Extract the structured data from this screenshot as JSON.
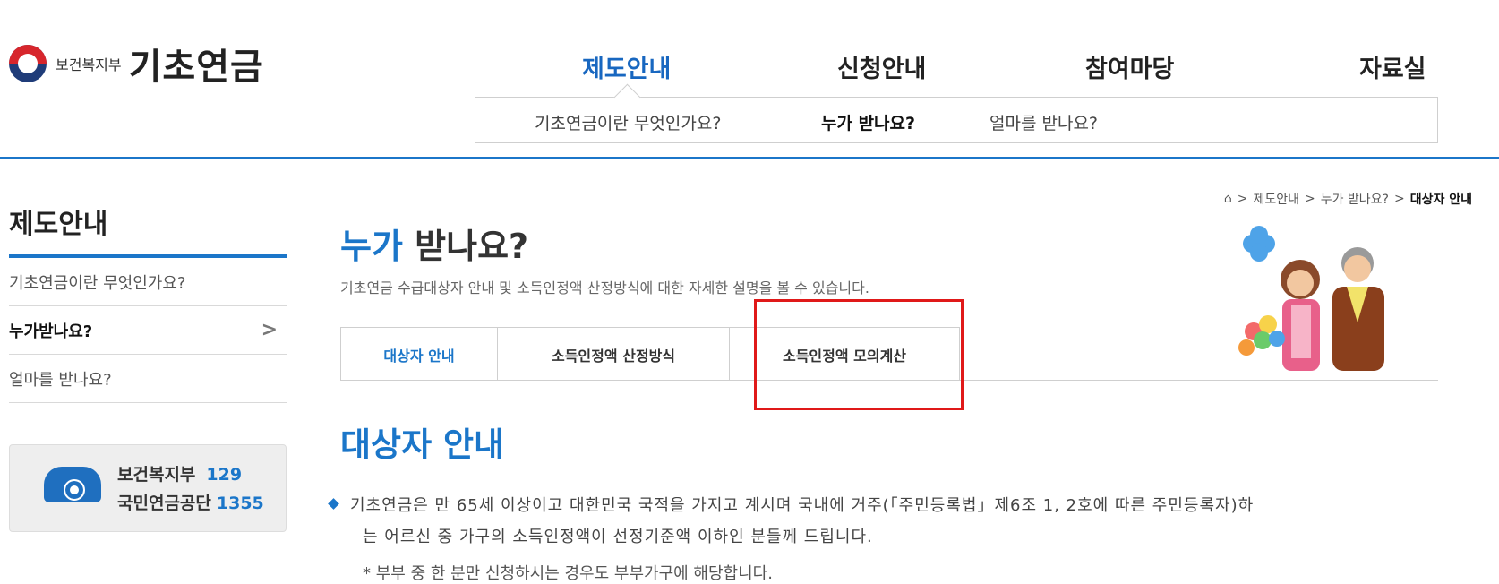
{
  "header": {
    "logo_sub": "보건복지부",
    "logo_title": "기초연금",
    "nav": [
      {
        "label": "제도안내",
        "active": true
      },
      {
        "label": "신청안내",
        "active": false
      },
      {
        "label": "참여마당",
        "active": false
      },
      {
        "label": "자료실",
        "active": false
      }
    ],
    "sub_menu": [
      {
        "label": "기초연금이란 무엇인가요?",
        "active": false
      },
      {
        "label": "누가 받나요?",
        "active": true
      },
      {
        "label": "얼마를 받나요?",
        "active": false
      }
    ]
  },
  "breadcrumb": {
    "home_icon": "home-icon",
    "items": [
      "제도안내",
      "누가 받나요?"
    ],
    "current": "대상자 안내",
    "separator": ">"
  },
  "sidebar": {
    "title": "제도안내",
    "items": [
      {
        "label": "기초연금이란 무엇인가요?",
        "active": false
      },
      {
        "label": "누가받나요?",
        "active": true,
        "chevron": ">"
      },
      {
        "label": "얼마를 받나요?",
        "active": false
      }
    ],
    "contact": {
      "icon": "phone-icon",
      "lines": [
        {
          "label": "보건복지부",
          "number": "129"
        },
        {
          "label": "국민연금공단",
          "number": "1355"
        }
      ]
    }
  },
  "main": {
    "title_highlight": "누가",
    "title_rest": " 받나요?",
    "description": "기초연금 수급대상자 안내 및 소득인정액 산정방식에 대한 자세한 설명을 볼 수 있습니다.",
    "tabs": [
      {
        "label": "대상자 안내",
        "active": true
      },
      {
        "label": "소득인정액 산정방식",
        "active": false
      },
      {
        "label": "소득인정액 모의계산",
        "active": false
      }
    ],
    "section_title": "대상자 안내",
    "bullet": {
      "line1": "기초연금은 만 65세 이상이고 대한민국 국적을 가지고 계시며 국내에 거주(「주민등록법」제6조 1, 2호에 따른 주민등록자)하",
      "line2": "는 어르신 중 가구의 소득인정액이 선정기준액 이하인 분들께 드립니다."
    },
    "note": "* 부부 중 한 분만 신청하시는 경우도 부부가구에 해당합니다."
  },
  "colors": {
    "accent": "#1b76c9",
    "highlight_box": "#e01919"
  }
}
